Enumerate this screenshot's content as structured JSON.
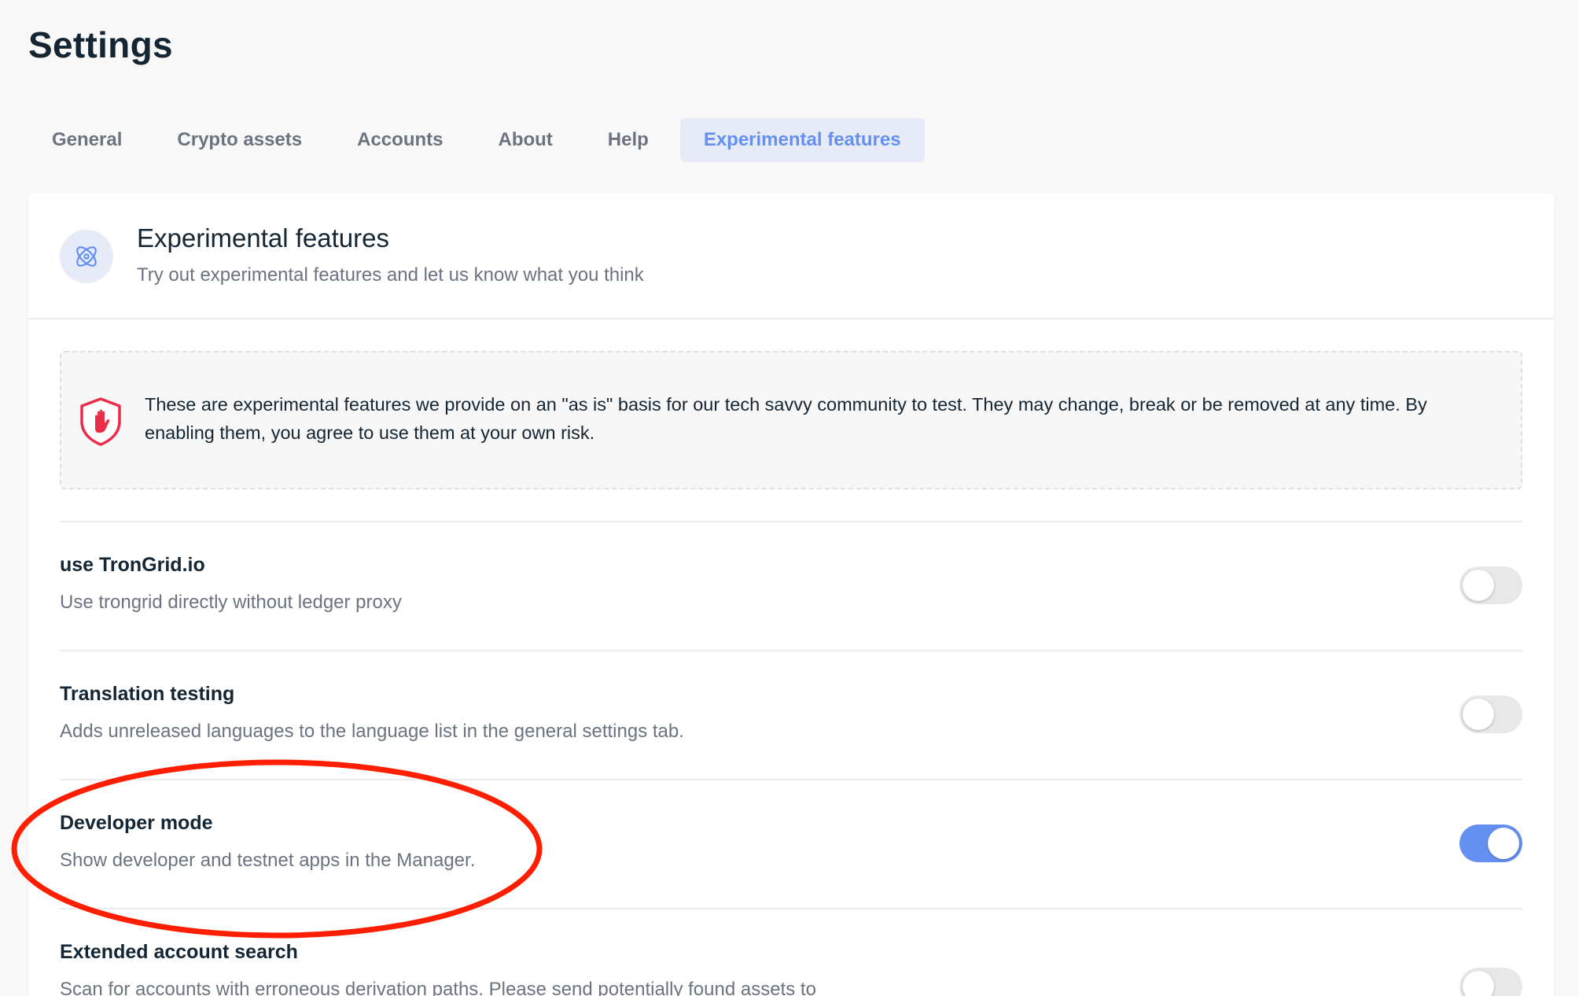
{
  "page": {
    "title": "Settings"
  },
  "tabs": [
    {
      "label": "General",
      "active": false
    },
    {
      "label": "Crypto assets",
      "active": false
    },
    {
      "label": "Accounts",
      "active": false
    },
    {
      "label": "About",
      "active": false
    },
    {
      "label": "Help",
      "active": false
    },
    {
      "label": "Experimental features",
      "active": true
    }
  ],
  "section": {
    "icon": "atom-icon",
    "title": "Experimental features",
    "subtitle": "Try out experimental features and let us know what you think"
  },
  "warning": {
    "icon": "shield-hand-icon",
    "text": "These are experimental features we provide on an \"as is\" basis for our tech savvy community to test. They may change, break or be removed at any time. By enabling them, you agree to use them at your own risk."
  },
  "features": [
    {
      "title": "use TronGrid.io",
      "description": "Use trongrid directly without ledger proxy",
      "enabled": false
    },
    {
      "title": "Translation testing",
      "description": "Adds unreleased languages to the language list in the general settings tab.",
      "enabled": false
    },
    {
      "title": "Developer mode",
      "description": "Show developer and testnet apps in the Manager.",
      "enabled": true
    },
    {
      "title": "Extended account search",
      "description": "Scan for accounts with erroneous derivation paths. Please send potentially found assets to",
      "enabled": false
    }
  ],
  "colors": {
    "accent": "#6490f1",
    "accent_bg": "#e6ebf7",
    "danger": "#ea2e49",
    "annotation": "#ff1f00"
  }
}
